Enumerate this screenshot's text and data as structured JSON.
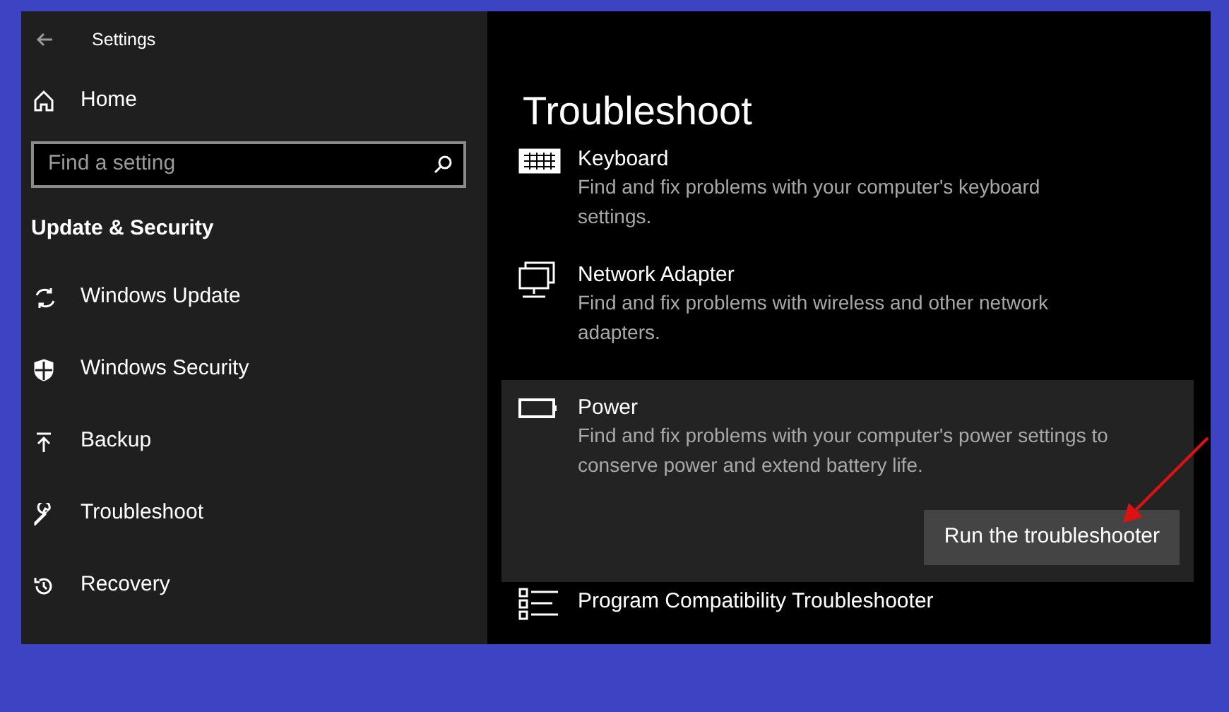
{
  "window": {
    "title": "Settings"
  },
  "sidebar": {
    "home": "Home",
    "search": {
      "placeholder": "Find a setting"
    },
    "section": "Update & Security",
    "items": [
      {
        "label": "Windows Update"
      },
      {
        "label": "Windows Security"
      },
      {
        "label": "Backup"
      },
      {
        "label": "Troubleshoot"
      },
      {
        "label": "Recovery"
      }
    ]
  },
  "main": {
    "title": "Troubleshoot",
    "items": [
      {
        "title": "Keyboard",
        "description": "Find and fix problems with your computer's keyboard settings.",
        "expanded": false
      },
      {
        "title": "Network Adapter",
        "description": "Find and fix problems with wireless and other network adapters.",
        "expanded": false
      },
      {
        "title": "Power",
        "description": "Find and fix problems with your computer's power settings to conserve power and extend battery life.",
        "expanded": true,
        "button": "Run the troubleshooter"
      },
      {
        "title": "Program Compatibility Troubleshooter",
        "expanded": false
      }
    ]
  }
}
